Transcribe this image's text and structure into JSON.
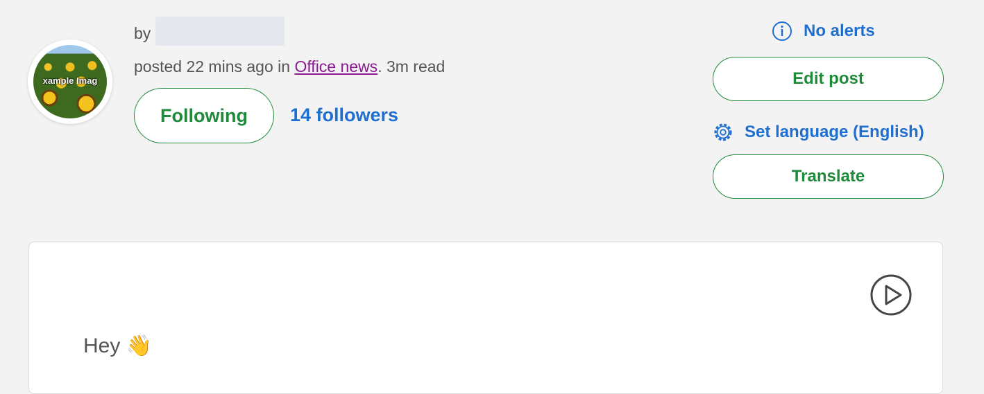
{
  "author": {
    "avatar_overlay_text": "xample Imag",
    "by_label": "by"
  },
  "post_meta": {
    "posted_prefix": "posted 22 mins ago in ",
    "category_link": "Office news",
    "read_suffix": ". 3m read"
  },
  "follow": {
    "button_label": "Following",
    "followers_label": "14 followers"
  },
  "actions": {
    "alerts_label": "No alerts",
    "edit_label": "Edit post",
    "language_label": "Set language (English)",
    "translate_label": "Translate"
  },
  "content": {
    "greeting": "Hey 👋"
  },
  "colors": {
    "accent_green": "#1f8a3a",
    "link_blue": "#1f6fd1",
    "visited_link": "#8b1a92",
    "background": "#f3f3f3"
  },
  "icons": {
    "alerts": "info-icon",
    "language": "gear-icon",
    "play": "play-icon"
  }
}
